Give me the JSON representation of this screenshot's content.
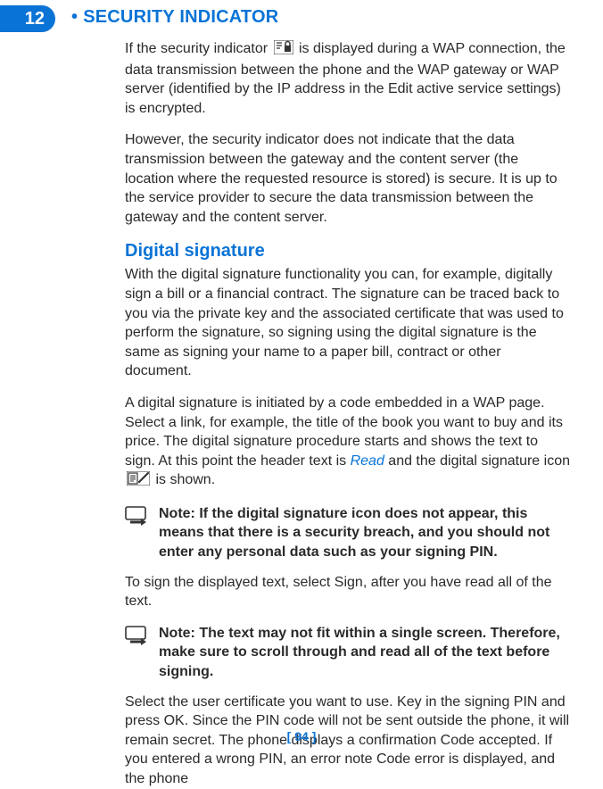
{
  "chapter_number": "12",
  "heading_bullet": "•",
  "heading_text": "SECURITY INDICATOR",
  "para1_a": "If the security indicator ",
  "para1_b": " is displayed during a WAP connection, the data transmission between the phone and the WAP gateway or WAP server (identified by the IP address in the Edit active service settings) is encrypted.",
  "para2": "However, the security  indicator does not indicate that the data transmission between the gateway and the content server (the location where the requested resource is stored) is secure. It is up to the service provider to secure the data transmission between the gateway and the content server.",
  "subheading": "Digital signature",
  "para3": "With the digital signature functionality you can, for example, digitally sign a bill or a financial contract. The signature can be traced back to you via the private key and the associated certificate that was used to perform the signature, so signing using the digital signature is the same as signing your name to a paper bill, contract or other document.",
  "para4_a": "A digital signature is initiated by a code embedded in a WAP page. Select a link, for example, the title of the book you want to buy and its price. The digital signature procedure starts and shows the text to sign. At this point the header text is ",
  "para4_read": "Read",
  "para4_b": " and the digital signature icon ",
  "para4_c": " is shown.",
  "note1_label": "Note:",
  "note1_text": " If the digital signature icon does not appear, this means that there is a security breach, and you should not enter any personal data such as your signing PIN.",
  "para5": "To sign the displayed text, select Sign, after you have read all of the text.",
  "note2_label": "Note:",
  "note2_text": " The text may not fit within a single screen. Therefore, make sure to scroll through and read all of the text before signing.",
  "para6": "Select the user certificate you want to use. Key in the signing PIN and press OK. Since the PIN code will not be sent outside the phone, it will remain secret. The phone displays a confirmation Code accepted. If you entered a wrong PIN, an error note Code error is displayed, and the phone",
  "footer": "[ 94 ]"
}
